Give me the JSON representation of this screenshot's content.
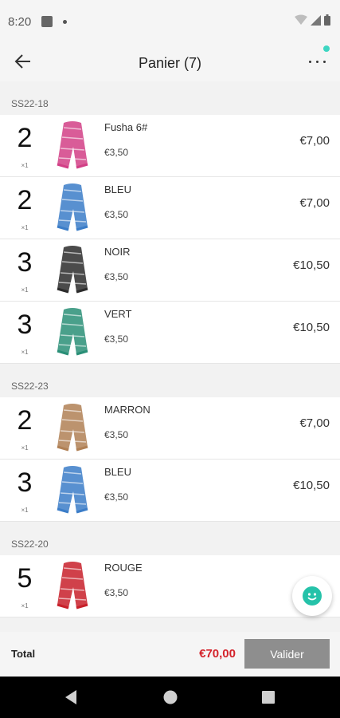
{
  "status_bar": {
    "time": "8:20"
  },
  "app_bar": {
    "title": "Panier (7)"
  },
  "groups": [
    {
      "code": "SS22-18",
      "items": [
        {
          "qty": "2",
          "unit": "×1",
          "name": "Fusha 6#",
          "unit_price": "€3,50",
          "total": "€7,00",
          "color": "#d23f86"
        },
        {
          "qty": "2",
          "unit": "×1",
          "name": "BLEU",
          "unit_price": "€3,50",
          "total": "€7,00",
          "color": "#3b7dc8"
        },
        {
          "qty": "3",
          "unit": "×1",
          "name": "NOIR",
          "unit_price": "€3,50",
          "total": "€10,50",
          "color": "#2b2b2b"
        },
        {
          "qty": "3",
          "unit": "×1",
          "name": "VERT",
          "unit_price": "€3,50",
          "total": "€10,50",
          "color": "#2a8f77"
        }
      ]
    },
    {
      "code": "SS22-23",
      "items": [
        {
          "qty": "2",
          "unit": "×1",
          "name": "MARRON",
          "unit_price": "€3,50",
          "total": "€7,00",
          "color": "#b08055"
        },
        {
          "qty": "3",
          "unit": "×1",
          "name": "BLEU",
          "unit_price": "€3,50",
          "total": "€10,50",
          "color": "#3b7dc8"
        }
      ]
    },
    {
      "code": "SS22-20",
      "items": [
        {
          "qty": "5",
          "unit": "×1",
          "name": "ROUGE",
          "unit_price": "€3,50",
          "total": "",
          "color": "#c8202a"
        }
      ]
    }
  ],
  "footer": {
    "total_label": "Total",
    "total_value": "€70,00",
    "validate_label": "Valider"
  }
}
